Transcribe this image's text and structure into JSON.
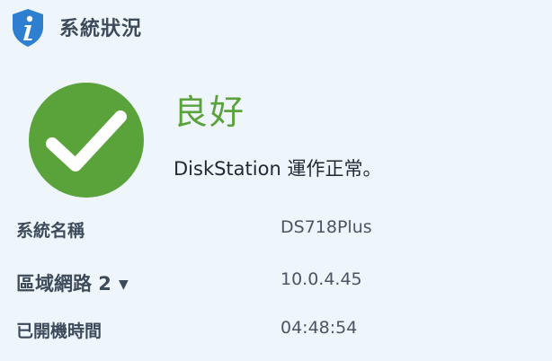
{
  "header": {
    "title": "系統狀況",
    "icon": "info-shield-icon"
  },
  "status": {
    "level": "良好",
    "message": "DiskStation 運作正常。",
    "icon": "checkmark-circle-icon",
    "color": "#5aa23a"
  },
  "info": [
    {
      "label": "系統名稱",
      "value": "DS718Plus"
    },
    {
      "label": "區域網路 2",
      "value": "10.0.4.45"
    },
    {
      "label": "已開機時間",
      "value": "04:48:54"
    }
  ],
  "colors": {
    "background": "#eef5fb",
    "shield_blue": "#2f7fd0"
  }
}
